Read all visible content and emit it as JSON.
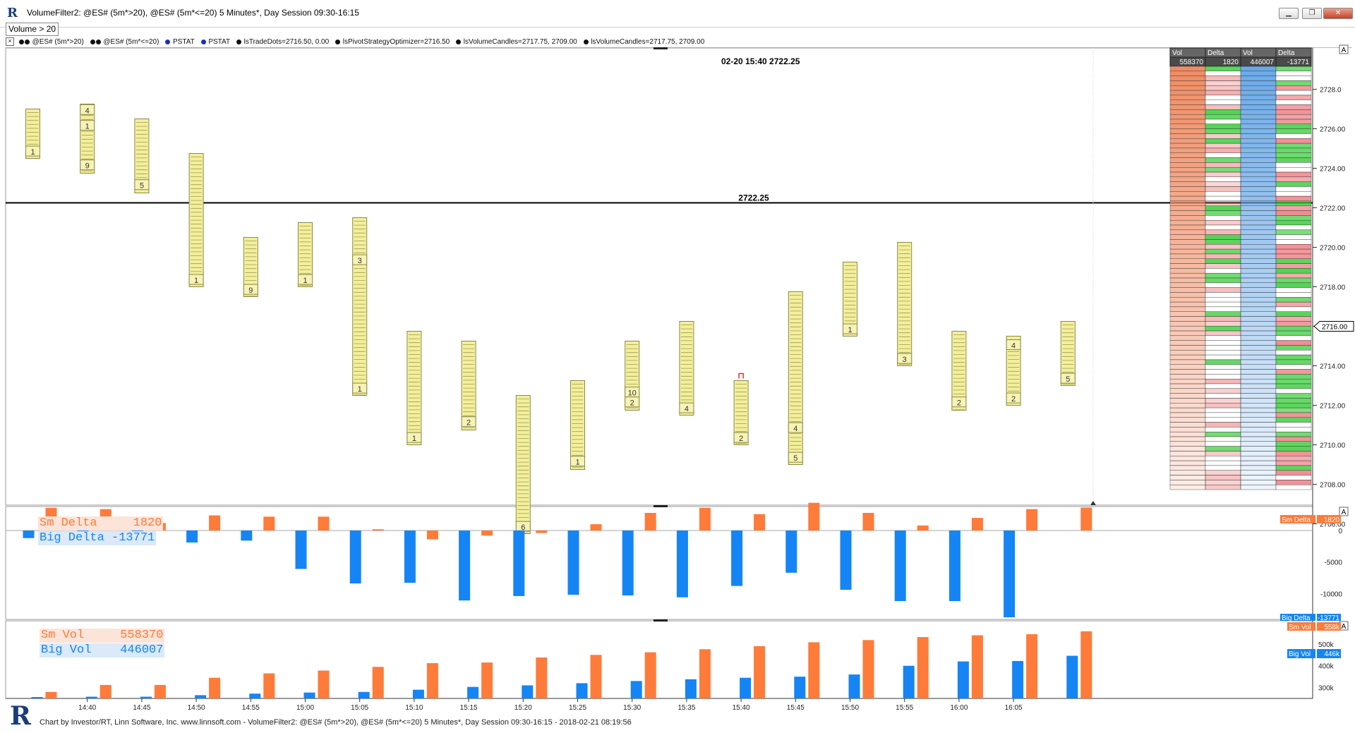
{
  "window": {
    "title": "VolumeFilter2: @ES# (5m*>20), @ES# (5m*<=20) 5 Minutes*, Day Session 09:30-16:15",
    "min_icon": "minimize-icon",
    "max_icon": "maximize-icon",
    "close_icon": "close-icon"
  },
  "filter_label": "Volume > 20",
  "indicator_bar": {
    "close_glyph": "×",
    "items": [
      "@ES# (5m*>20)",
      "@ES# (5m*<=20)",
      "PSTAT",
      "PSTAT",
      "lsTradeDots=2716.50, 0.00",
      "lsPivotStrategyOptimizer=2716.50",
      "lsVolumeCandles=2717.75, 2709.00",
      "lsVolumeCandles=2717.75, 2709.00"
    ]
  },
  "info_label": "02-20 15:40  2722.25",
  "hline_label": "2722.25",
  "price_marker": "2716.00",
  "panel_a_labels": [
    "A",
    "A",
    "A"
  ],
  "colors": {
    "candle_fill": "#f3ef9a",
    "candle_line": "#8c8a4a",
    "sm": "#ff7b3a",
    "big": "#1585f5",
    "grid": "#7a7a7a"
  },
  "ladder": {
    "headers": [
      "Vol",
      "Delta",
      "Vol",
      "Delta"
    ],
    "totals": [
      "558370",
      "1820",
      "446007",
      "-13771"
    ]
  },
  "chart_data": [
    {
      "type": "bar",
      "title": "",
      "subtitle": "volume-filtered range candles (price)",
      "x_ticks": [
        "14:40",
        "14:45",
        "14:50",
        "14:55",
        "15:00",
        "15:05",
        "15:10",
        "15:15",
        "15:20",
        "15:25",
        "15:30",
        "15:35",
        "15:40",
        "15:45",
        "15:50",
        "15:55",
        "16:00",
        "16:05"
      ],
      "y_ticks": [
        "2728.0",
        "2726.00",
        "2724.00",
        "2722.00",
        "2720.00",
        "2718.00",
        "2716.00",
        "2714.00",
        "2712.00",
        "2710.00",
        "2708.00",
        "2706.00"
      ],
      "ylim": [
        2705.0,
        2728.5
      ],
      "candles": [
        {
          "time": "14:35",
          "high": 2727.0,
          "low": 2724.5,
          "labels": [
            {
              "text": "1",
              "price": 2724.8
            }
          ]
        },
        {
          "time": "14:40",
          "high": 2727.25,
          "low": 2723.75,
          "labels": [
            {
              "text": "4",
              "price": 2726.9
            },
            {
              "text": "1",
              "price": 2726.1
            },
            {
              "text": "9",
              "price": 2724.1
            }
          ]
        },
        {
          "time": "14:45",
          "high": 2726.5,
          "low": 2722.75,
          "labels": [
            {
              "text": "5",
              "price": 2723.1
            }
          ]
        },
        {
          "time": "14:50",
          "high": 2724.75,
          "low": 2718.0,
          "labels": [
            {
              "text": "1",
              "price": 2718.3
            }
          ]
        },
        {
          "time": "14:55",
          "high": 2720.5,
          "low": 2717.5,
          "labels": [
            {
              "text": "9",
              "price": 2717.8
            }
          ]
        },
        {
          "time": "15:00",
          "high": 2721.25,
          "low": 2718.0,
          "labels": [
            {
              "text": "1",
              "price": 2718.3
            }
          ]
        },
        {
          "time": "15:05",
          "high": 2721.5,
          "low": 2712.5,
          "labels": [
            {
              "text": "3",
              "price": 2719.3
            },
            {
              "text": "1",
              "price": 2712.8
            }
          ]
        },
        {
          "time": "15:10",
          "high": 2715.75,
          "low": 2710.0,
          "labels": [
            {
              "text": "1",
              "price": 2710.3
            }
          ]
        },
        {
          "time": "15:15",
          "high": 2715.25,
          "low": 2710.75,
          "labels": [
            {
              "text": "2",
              "price": 2711.1
            }
          ]
        },
        {
          "time": "15:20",
          "high": 2712.5,
          "low": 2705.5,
          "labels": [
            {
              "text": "6",
              "price": 2705.8
            }
          ]
        },
        {
          "time": "15:25",
          "high": 2713.25,
          "low": 2708.75,
          "labels": [
            {
              "text": "1",
              "price": 2709.1
            }
          ]
        },
        {
          "time": "15:30",
          "high": 2715.25,
          "low": 2711.75,
          "labels": [
            {
              "text": "10",
              "price": 2712.6
            },
            {
              "text": "2",
              "price": 2712.1
            }
          ]
        },
        {
          "time": "15:35",
          "high": 2716.25,
          "low": 2711.5,
          "labels": [
            {
              "text": "4",
              "price": 2711.8
            }
          ]
        },
        {
          "time": "15:40",
          "high": 2713.25,
          "low": 2710.0,
          "labels": [
            {
              "text": "2",
              "price": 2710.3
            }
          ]
        },
        {
          "time": "15:45",
          "high": 2717.75,
          "low": 2709.0,
          "labels": [
            {
              "text": "4",
              "price": 2710.8
            },
            {
              "text": "5",
              "price": 2709.3
            }
          ]
        },
        {
          "time": "15:50",
          "high": 2719.25,
          "low": 2715.5,
          "labels": [
            {
              "text": "1",
              "price": 2715.8
            }
          ]
        },
        {
          "time": "15:55",
          "high": 2720.25,
          "low": 2714.0,
          "labels": [
            {
              "text": "3",
              "price": 2714.3
            }
          ]
        },
        {
          "time": "16:00",
          "high": 2715.75,
          "low": 2711.75,
          "labels": [
            {
              "text": "2",
              "price": 2712.1
            }
          ]
        },
        {
          "time": "16:05",
          "high": 2715.5,
          "low": 2712.0,
          "labels": [
            {
              "text": "4",
              "price": 2715.0
            },
            {
              "text": "2",
              "price": 2712.3
            }
          ]
        },
        {
          "time": "16:10",
          "high": 2716.25,
          "low": 2713.0,
          "labels": [
            {
              "text": "5",
              "price": 2713.3
            }
          ]
        }
      ],
      "hline": 2722.25
    },
    {
      "type": "bar",
      "title": "",
      "y_ticks": [
        "0",
        "-5000",
        "-10000"
      ],
      "ylim": [
        -13771,
        2000
      ],
      "series": [
        {
          "name": "Sm Delta",
          "value_label": "1820",
          "values": [
            1800,
            1700,
            600,
            1200,
            1100,
            1100,
            100,
            -700,
            -400,
            -200,
            500,
            1400,
            1800,
            1300,
            2200,
            1400,
            400,
            1000,
            1700,
            1820
          ]
        },
        {
          "name": "Big Delta",
          "value_label": "-13771",
          "values": [
            -1200,
            -300,
            -2200,
            -1900,
            -1600,
            -6100,
            -8400,
            -8300,
            -11100,
            -10400,
            -10200,
            -10300,
            -10600,
            -8800,
            -6700,
            -9400,
            -11200,
            -11200,
            -13771,
            0
          ]
        }
      ]
    },
    {
      "type": "bar",
      "title": "",
      "y_ticks": [
        "500k",
        "400k",
        "300k"
      ],
      "ylim": [
        250000,
        600000
      ],
      "series": [
        {
          "name": "Sm Vol",
          "value_label": "558370",
          "values": [
            280000,
            312000,
            312000,
            345000,
            365000,
            378000,
            395000,
            412000,
            415000,
            438000,
            450000,
            462000,
            476000,
            490000,
            508000,
            518000,
            532000,
            540000,
            545000,
            558370
          ]
        },
        {
          "name": "Big Vol",
          "value_label": "446007",
          "values": [
            250000,
            258000,
            258000,
            265000,
            272000,
            277000,
            280000,
            290000,
            303000,
            310000,
            320000,
            330000,
            338000,
            345000,
            350000,
            360000,
            400000,
            420000,
            422000,
            446007
          ]
        }
      ],
      "axis_tags": [
        "558k",
        "446k"
      ]
    }
  ],
  "footer": {
    "logo": "R",
    "text": "Chart by Investor/RT, Linn Software, Inc. www.linnsoft.com - VolumeFilter2: @ES# (5m*>20), @ES# (5m*<=20) 5 Minutes*, Day Session 09:30-16:15 - 2018-02-21 08:19:56"
  }
}
